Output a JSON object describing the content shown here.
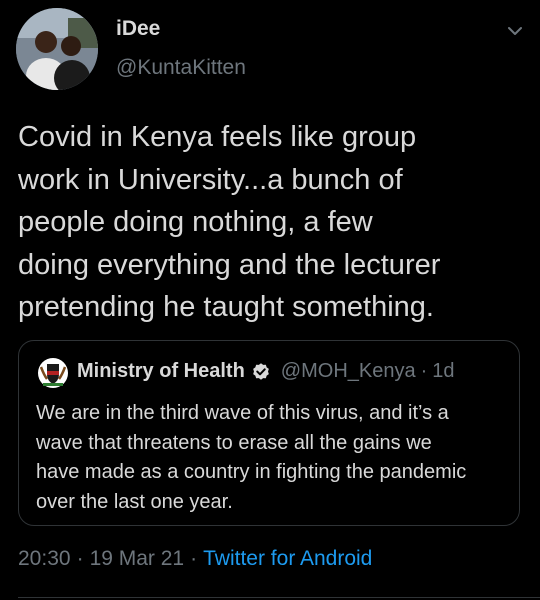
{
  "tweet": {
    "author": {
      "name": "iDee",
      "handle": "@KuntaKitten"
    },
    "text_lines": [
      "Covid in Kenya feels like group",
      "work in University...a bunch of",
      "people doing nothing,  a few",
      "doing everything and the lecturer",
      "pretending he taught something."
    ],
    "quoted": {
      "name": "Ministry of Health",
      "handle": "@MOH_Kenya",
      "separator": "·",
      "time": "1d",
      "text_lines": [
        "We are in the third wave of this virus, and it’s a",
        "wave that threatens to erase all the gains we",
        "have made as a country in fighting the pandemic",
        "over the last one year."
      ]
    },
    "meta": {
      "time": "20:30",
      "date": "19 Mar 21",
      "separator": "·",
      "source": "Twitter for Android"
    }
  },
  "colors": {
    "background": "#000000",
    "text": "#d9d9d9",
    "secondary": "#6e767d",
    "link": "#1d9bf0",
    "border": "#2f3336"
  },
  "icons": {
    "menu": "chevron-down-icon",
    "verified": "verified-badge-icon",
    "quoted_avatar": "coat-of-arms-icon"
  }
}
